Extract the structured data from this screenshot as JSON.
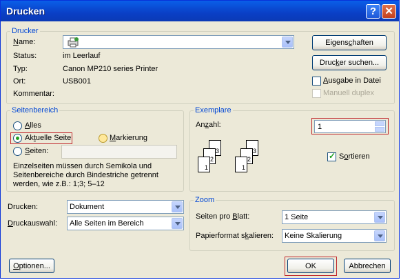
{
  "title": "Drucken",
  "titlebar": {
    "help_glyph": "?",
    "close_glyph": "✕"
  },
  "printer": {
    "legend": "Drucker",
    "name_label": "Name:",
    "name_value": "",
    "status_label": "Status:",
    "status_value": "im Leerlauf",
    "type_label": "Typ:",
    "type_value": "Canon MP210 series Printer",
    "location_label": "Ort:",
    "location_value": "USB001",
    "comment_label": "Kommentar:",
    "comment_value": "",
    "properties_button": "Eigenschaften",
    "find_printer_button": "Drucker suchen...",
    "print_to_file": "Ausgabe in Datei",
    "manual_duplex": "Manuell duplex"
  },
  "range": {
    "legend": "Seitenbereich",
    "all": "Alles",
    "current_page": "Aktuelle Seite",
    "selection": "Markierung",
    "pages": "Seiten:",
    "pages_value": "",
    "hint_line1": "Einzelseiten müssen durch Semikola und",
    "hint_line2": "Seitenbereiche durch Bindestriche getrennt",
    "hint_line3": "werden, wie z.B.: 1;3; 5–12"
  },
  "copies": {
    "legend": "Exemplare",
    "count_label": "Anzahl:",
    "count_value": "1",
    "collate": "Sortieren",
    "collate_checked": true,
    "page_labels": [
      "1",
      "2",
      "3"
    ]
  },
  "print_what": {
    "label": "Drucken:",
    "value": "Dokument"
  },
  "print_selection": {
    "label": "Druckauswahl:",
    "value": "Alle Seiten im Bereich"
  },
  "zoom": {
    "legend": "Zoom",
    "pages_per_sheet_label": "Seiten pro Blatt:",
    "pages_per_sheet_value": "1 Seite",
    "scale_label": "Papierformat skalieren:",
    "scale_value": "Keine Skalierung"
  },
  "buttons": {
    "options": "Optionen...",
    "ok": "OK",
    "cancel": "Abbrechen"
  },
  "colors": {
    "title_bar": "#0a4fd6",
    "legend": "#0046d5",
    "highlight_box": "#c0282d",
    "dialog_bg": "#ece9d8"
  }
}
